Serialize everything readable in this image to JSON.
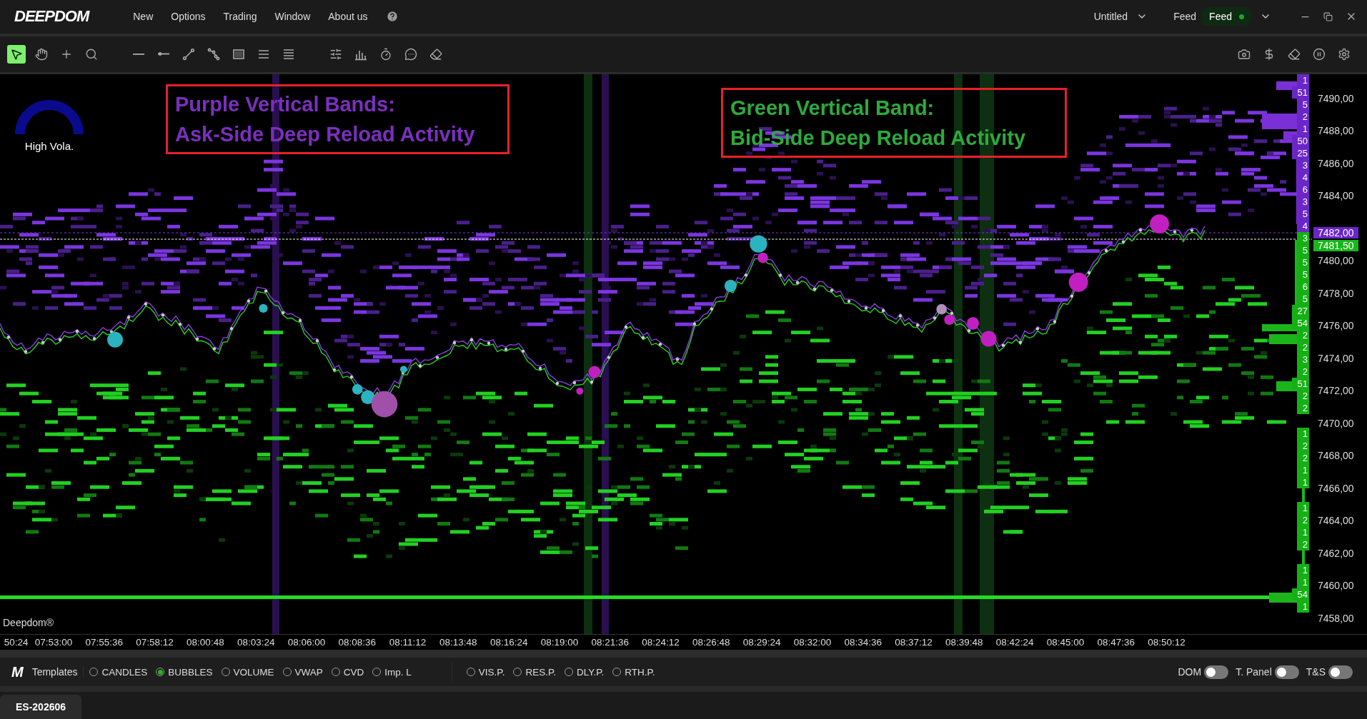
{
  "menu_bar": {
    "logo": "DEEPDOM",
    "items": [
      "New",
      "Options",
      "Trading",
      "Window",
      "About us"
    ],
    "workspace": "Untitled",
    "feed_label": "Feed",
    "feed_status": {
      "text": "Feed",
      "connected": true
    }
  },
  "toolbar": {
    "tools": [
      {
        "kind": "pointer",
        "selected": true
      },
      {
        "kind": "hand",
        "selected": false
      },
      {
        "kind": "crosshair",
        "selected": false
      },
      {
        "kind": "zoom",
        "selected": false
      },
      {
        "kind": "hline",
        "selected": false
      },
      {
        "kind": "ray",
        "selected": false
      },
      {
        "kind": "trend",
        "selected": false
      },
      {
        "kind": "path",
        "selected": false
      },
      {
        "kind": "rect",
        "selected": false
      },
      {
        "kind": "lines3",
        "selected": false
      },
      {
        "kind": "lines4",
        "selected": false
      },
      {
        "kind": "sliders",
        "selected": false
      },
      {
        "kind": "bars",
        "selected": false
      },
      {
        "kind": "timer",
        "selected": false
      },
      {
        "kind": "comment",
        "selected": false
      },
      {
        "kind": "eraser",
        "selected": false
      }
    ],
    "right_tools": [
      {
        "kind": "camera"
      },
      {
        "kind": "dollar"
      },
      {
        "kind": "eraser"
      },
      {
        "kind": "pause"
      },
      {
        "kind": "settings"
      }
    ]
  },
  "chart": {
    "gauge_label": "High Vola.",
    "annotations": [
      {
        "color": "#7b2fbe",
        "lines": [
          "Purple Vertical Bands:",
          "Ask-Side Deep Reload Activity"
        ]
      },
      {
        "color": "#2eaa3c",
        "lines": [
          "Green Vertical Band:",
          "Bid-Side Deep Reload Activity"
        ]
      }
    ],
    "brand": "Deepdom®",
    "ladder": [
      {
        "cells": [
          {
            "text": "1",
            "kind": "ask"
          },
          {
            "text": "51",
            "kind": "ask"
          },
          {
            "text": "5",
            "kind": "ask"
          },
          {
            "text": "2",
            "kind": "ask"
          },
          {
            "text": "1",
            "kind": "ask"
          },
          {
            "text": "50",
            "kind": "ask"
          },
          {
            "text": "25",
            "kind": "ask"
          },
          {
            "text": "3",
            "kind": "ask"
          },
          {
            "text": "4",
            "kind": "ask"
          },
          {
            "text": "6",
            "kind": "ask"
          },
          {
            "text": "3",
            "kind": "ask"
          },
          {
            "text": "5",
            "kind": "ask"
          },
          {
            "text": "4",
            "kind": "ask"
          },
          {
            "text": "3",
            "kind": "bid"
          },
          {
            "text": "5",
            "kind": "bid"
          },
          {
            "text": "5",
            "kind": "bid"
          },
          {
            "text": "5",
            "kind": "bid"
          },
          {
            "text": "6",
            "kind": "bid"
          },
          {
            "text": "5",
            "kind": "bid"
          },
          {
            "text": "27",
            "kind": "bid"
          },
          {
            "text": "54",
            "kind": "bid"
          },
          {
            "text": "2",
            "kind": "bid"
          },
          {
            "text": "2",
            "kind": "bid"
          },
          {
            "text": "3",
            "kind": "bid"
          },
          {
            "text": "2",
            "kind": "bid"
          },
          {
            "text": "51",
            "kind": "bid"
          },
          {
            "text": "2",
            "kind": "bid"
          },
          {
            "text": "2",
            "kind": "bid"
          }
        ]
      },
      {
        "cells": [
          {
            "text": "1",
            "kind": "bid"
          },
          {
            "text": "2",
            "kind": "bid"
          },
          {
            "text": "2",
            "kind": "bid"
          },
          {
            "text": "1",
            "kind": "bid"
          },
          {
            "text": "1",
            "kind": "bid"
          }
        ]
      },
      {
        "cells": [
          {
            "text": "1",
            "kind": "bid"
          },
          {
            "text": "2",
            "kind": "bid"
          },
          {
            "text": "1",
            "kind": "bid"
          },
          {
            "text": "2",
            "kind": "bid"
          }
        ]
      },
      {
        "cells": [
          {
            "text": "1",
            "kind": "bid"
          },
          {
            "text": "1",
            "kind": "bid"
          },
          {
            "text": "54",
            "kind": "bid"
          },
          {
            "text": "1",
            "kind": "bid"
          }
        ]
      }
    ],
    "price_axis": {
      "upper_labels": [
        "7490,00",
        "7488,00",
        "7486,00",
        "7484,00"
      ],
      "lower_labels": [
        "7480,00",
        "7478,00",
        "7476,00",
        "7474,00",
        "7472,00",
        "7470,00",
        "7468,00",
        "7466,00",
        "7464,00",
        "7462,00",
        "7460,00",
        "7458,00"
      ],
      "ask_price": "7482,00",
      "bid_price": "7481,50"
    },
    "time_axis": [
      "50:24",
      "07:53:00",
      "07:55:36",
      "07:58:12",
      "08:00:48",
      "08:03:24",
      "08:06:00",
      "08:08:36",
      "08:11:12",
      "08:13:48",
      "08:16:24",
      "08:19:00",
      "08:21:36",
      "08:24:12",
      "08:26:48",
      "08:29:24",
      "08:32:00",
      "08:34:36",
      "08:37:12",
      "08:39:48",
      "08:42:24",
      "08:45:00",
      "08:47:36",
      "08:50:12"
    ]
  },
  "bottom_bar": {
    "logo": "M",
    "label": "Templates",
    "chart_modes": [
      {
        "label": "CANDLES",
        "selected": false
      },
      {
        "label": "BUBBLES",
        "selected": true
      },
      {
        "label": "VOLUME",
        "selected": false
      },
      {
        "label": "VWAP",
        "selected": false
      },
      {
        "label": "CVD",
        "selected": false
      },
      {
        "label": "Imp. L",
        "selected": false
      }
    ],
    "profiles": [
      {
        "label": "VIS.P.",
        "selected": false
      },
      {
        "label": "RES.P.",
        "selected": false
      },
      {
        "label": "DLY.P.",
        "selected": false
      },
      {
        "label": "RTH.P.",
        "selected": false
      }
    ],
    "toggles": [
      {
        "label": "DOM",
        "on": false
      },
      {
        "label": "T. Panel",
        "on": false
      },
      {
        "label": "T&S",
        "on": false
      }
    ]
  },
  "tabs": [
    {
      "label": "ES-202606",
      "selected": true
    }
  ]
}
